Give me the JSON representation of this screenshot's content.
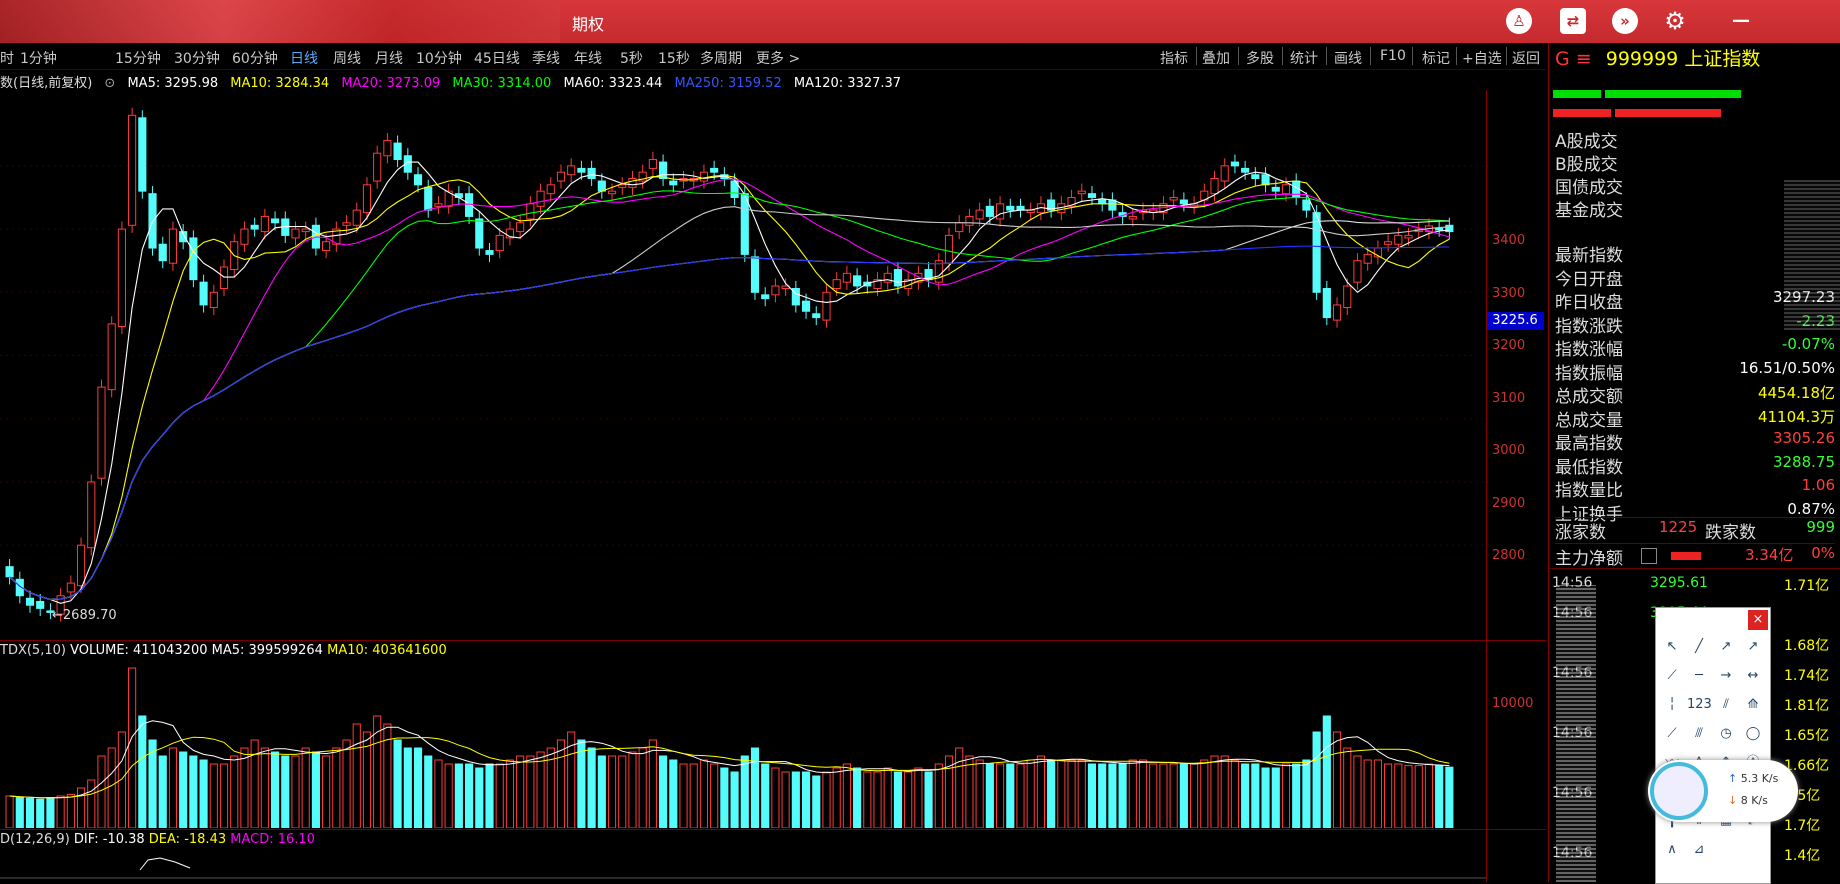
{
  "window": {
    "title": "期权",
    "colors": {
      "titlebar": "#c42a2e",
      "accent": "#5aa0ff"
    }
  },
  "titlebar_icons": [
    "shirt-icon",
    "switch-icon",
    "chevron-circle-icon",
    "gear-icon"
  ],
  "timeframes": {
    "partial_left": "时",
    "items": [
      "1分钟",
      "15分钟",
      "30分钟",
      "60分钟",
      "日线",
      "周线",
      "月线",
      "10分钟",
      "45日线",
      "季线",
      "年线",
      "5秒",
      "15秒",
      "多周期",
      "更多 >"
    ],
    "active": "日线"
  },
  "right_tools": [
    "指标",
    "叠加",
    "多股",
    "统计",
    "画线",
    "F10",
    "标记",
    "+自选",
    "返回"
  ],
  "ma_legend": {
    "prefix": "数(日线,前复权)",
    "items": [
      {
        "label": "MA5: 3295.98",
        "color": "#ffffff"
      },
      {
        "label": "MA10: 3284.34",
        "color": "#ffff00"
      },
      {
        "label": "MA20: 3273.09",
        "color": "#ff00ff"
      },
      {
        "label": "MA30: 3314.00",
        "color": "#00ff00"
      },
      {
        "label": "MA60: 3323.44",
        "color": "#ffffff"
      },
      {
        "label": "MA250: 3159.52",
        "color": "#3355ff"
      },
      {
        "label": "MA120: 3327.37",
        "color": "#ffffff"
      }
    ]
  },
  "price_axis": {
    "labels": [
      "3400",
      "3300",
      "3200",
      "3100",
      "3000",
      "2900",
      "2800"
    ],
    "current": "3225.6"
  },
  "low_marker": "2689.70",
  "volume": {
    "prefix": "TDX(5,10)",
    "items": [
      {
        "label": "VOLUME: 411043200",
        "color": "#ffffff"
      },
      {
        "label": "MA5: 399599264",
        "color": "#ffffff"
      },
      {
        "label": "MA10: 403641600",
        "color": "#ffff00"
      }
    ],
    "axis_label": "10000"
  },
  "macd": {
    "prefix": "D(12,26,9)",
    "items": [
      {
        "label": "DIF: -10.38",
        "color": "#ffffff"
      },
      {
        "label": "DEA: -18.43",
        "color": "#ffff00"
      },
      {
        "label": "MACD: 16.10",
        "color": "#ff00ff"
      }
    ]
  },
  "quote_panel": {
    "flag": "G ≡",
    "code": "999999",
    "name": "上证指数",
    "turnover_labels": [
      "A股成交",
      "B股成交",
      "国债成交",
      "基金成交"
    ],
    "stats": [
      {
        "label": "最新指数",
        "value": "",
        "color": "white"
      },
      {
        "label": "今日开盘",
        "value": "",
        "color": "white"
      },
      {
        "label": "昨日收盘",
        "value": "3297.23",
        "color": "white"
      },
      {
        "label": "指数涨跌",
        "value": "-2.23",
        "color": "green"
      },
      {
        "label": "指数涨幅",
        "value": "-0.07%",
        "color": "green"
      },
      {
        "label": "指数振幅",
        "value": "16.51/0.50%",
        "color": "white"
      },
      {
        "label": "总成交额",
        "value": "4454.18亿",
        "color": "yellow"
      },
      {
        "label": "总成交量",
        "value": "41104.3万",
        "color": "yellow"
      },
      {
        "label": "最高指数",
        "value": "3305.26",
        "color": "red"
      },
      {
        "label": "最低指数",
        "value": "3288.75",
        "color": "green"
      },
      {
        "label": "指数量比",
        "value": "1.06",
        "color": "red"
      },
      {
        "label": "上证换手",
        "value": "0.87%",
        "color": "white"
      }
    ],
    "advance_label": "涨家数",
    "advance_value": "1225",
    "decline_label": "跌家数",
    "decline_value": "999",
    "mainforce_label": "主力净额",
    "mainforce_value": "3.34亿",
    "mainforce_pct": "0%",
    "ticks": [
      {
        "time": "14:56",
        "price": "3295.61",
        "amount": "1.71亿"
      },
      {
        "time": "14:56",
        "price": "3295.44",
        "amount": ""
      },
      {
        "time": "",
        "price": "",
        "amount": "1.68亿"
      },
      {
        "time": "14:56",
        "price": "",
        "amount": "1.74亿"
      },
      {
        "time": "",
        "price": "",
        "amount": "1.81亿"
      },
      {
        "time": "14:56",
        "price": "",
        "amount": "1.65亿"
      },
      {
        "time": "",
        "price": "",
        "amount": "1.66亿"
      },
      {
        "time": "14:56",
        "price": "",
        "amount": "1.5亿"
      },
      {
        "time": "",
        "price": "",
        "amount": "1.7亿"
      },
      {
        "time": "14:56",
        "price": "",
        "amount": "1.4亿"
      }
    ]
  },
  "speed_widget": {
    "up": "5.3 K/s",
    "down": "8 K/s"
  },
  "draw_tool_icons": [
    "cursor-icon",
    "line-icon",
    "ray-icon",
    "arrow-icon",
    "segment-icon",
    "hline-icon",
    "hray-icon",
    "hsegment-icon",
    "vline-icon",
    "number-icon",
    "parallel-icon",
    "channel-icon",
    "trend-icon",
    "fib-icon",
    "clock-icon",
    "circle-icon",
    "wave-icon",
    "zigzag-icon",
    "price-icon",
    "label-icon",
    "rect-icon",
    "gann-icon",
    "fan-icon",
    "cycle-icon",
    "bar-icon",
    "period-icon",
    "grid-icon",
    "xabcd-icon",
    "chevron-up-icon",
    "measure-icon"
  ],
  "chart_data": {
    "type": "candlestick",
    "price_range": [
      2650,
      3520
    ],
    "ohlc_first": [
      2740,
      2700
    ],
    "close_series": [
      2750,
      2720,
      2705,
      2700,
      2695,
      2720,
      2740,
      2800,
      2900,
      3050,
      3150,
      3300,
      3480,
      3360,
      3270,
      3250,
      3300,
      3280,
      3220,
      3180,
      3200,
      3240,
      3280,
      3300,
      3300,
      3320,
      3310,
      3290,
      3300,
      3300,
      3270,
      3280,
      3300,
      3310,
      3330,
      3370,
      3420,
      3440,
      3410,
      3390,
      3370,
      3330,
      3340,
      3360,
      3350,
      3320,
      3270,
      3260,
      3290,
      3300,
      3310,
      3340,
      3360,
      3370,
      3390,
      3400,
      3390,
      3380,
      3360,
      3360,
      3370,
      3380,
      3390,
      3410,
      3380,
      3370,
      3380,
      3380,
      3390,
      3390,
      3380,
      3350,
      3260,
      3200,
      3190,
      3210,
      3210,
      3180,
      3170,
      3160,
      3200,
      3220,
      3230,
      3210,
      3210,
      3220,
      3230,
      3210,
      3220,
      3230,
      3220,
      3250,
      3290,
      3310,
      3320,
      3330,
      3320,
      3340,
      3330,
      3330,
      3330,
      3340,
      3330,
      3340,
      3350,
      3360,
      3350,
      3340,
      3330,
      3320,
      3320,
      3330,
      3330,
      3340,
      3350,
      3340,
      3340,
      3360,
      3380,
      3400,
      3400,
      3390,
      3380,
      3370,
      3360,
      3370,
      3350,
      3330,
      3200,
      3160,
      3180,
      3210,
      3250,
      3260,
      3270,
      3280,
      3290,
      3290,
      3300,
      3305,
      3300,
      3296
    ],
    "volume_series": [
      0.4,
      0.38,
      0.37,
      0.36,
      0.38,
      0.4,
      0.42,
      0.5,
      0.6,
      0.9,
      1.0,
      1.2,
      2.0,
      1.4,
      1.1,
      0.9,
      1.0,
      0.95,
      0.9,
      0.85,
      0.8,
      0.8,
      0.9,
      1.0,
      1.1,
      1.0,
      0.95,
      0.9,
      0.9,
      1.0,
      0.95,
      0.9,
      1.0,
      1.1,
      1.3,
      1.2,
      1.4,
      1.3,
      1.1,
      1.0,
      1.0,
      0.9,
      0.85,
      0.8,
      0.8,
      0.8,
      0.75,
      0.8,
      0.8,
      0.85,
      0.9,
      0.9,
      0.95,
      1.0,
      1.1,
      1.2,
      1.1,
      1.0,
      0.9,
      0.9,
      0.9,
      0.95,
      1.0,
      1.1,
      0.9,
      0.85,
      0.8,
      0.8,
      0.85,
      0.8,
      0.75,
      0.7,
      0.9,
      1.0,
      0.8,
      0.75,
      0.7,
      0.7,
      0.7,
      0.65,
      0.7,
      0.75,
      0.8,
      0.75,
      0.7,
      0.7,
      0.75,
      0.7,
      0.7,
      0.75,
      0.7,
      0.8,
      0.9,
      1.0,
      0.9,
      0.85,
      0.8,
      0.8,
      0.8,
      0.8,
      0.85,
      0.9,
      0.85,
      0.85,
      0.85,
      0.85,
      0.8,
      0.8,
      0.8,
      0.8,
      0.85,
      0.85,
      0.8,
      0.8,
      0.8,
      0.8,
      0.8,
      0.85,
      0.9,
      0.9,
      0.85,
      0.8,
      0.8,
      0.75,
      0.75,
      0.8,
      0.8,
      0.85,
      1.2,
      1.4,
      1.2,
      1.0,
      0.9,
      0.85,
      0.85,
      0.8,
      0.8,
      0.78,
      0.78,
      0.8,
      0.78,
      0.76
    ]
  }
}
